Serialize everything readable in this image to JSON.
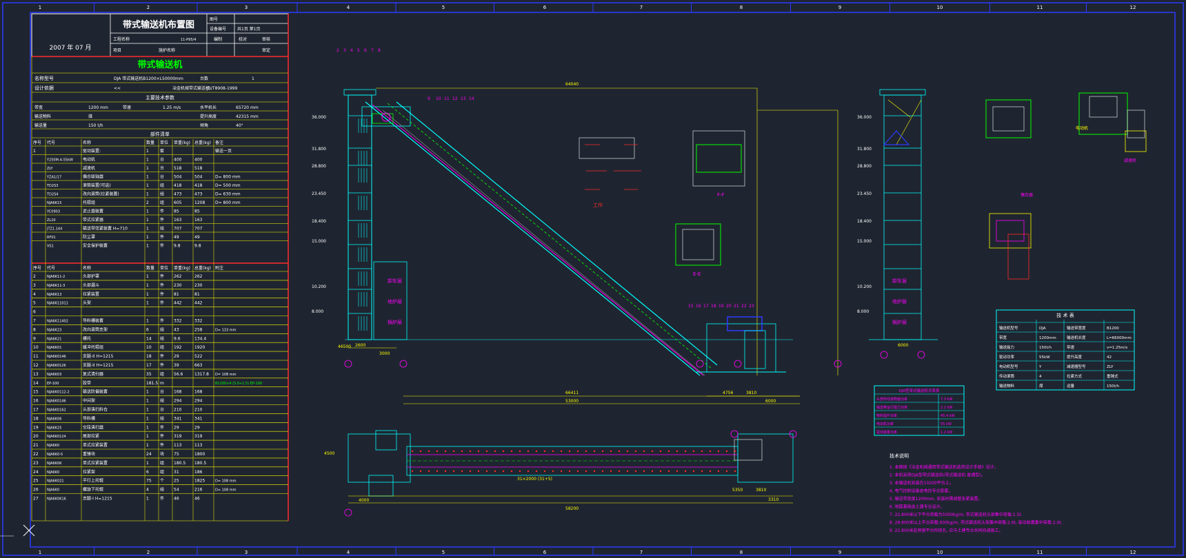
{
  "colors": {
    "bg": "#1f2530",
    "border": "#2b3bff",
    "red": "#ff2a2a",
    "yellow": "#ffff00",
    "cyan": "#00ffff",
    "green": "#00ff00",
    "magenta": "#ff00ff",
    "white": "#ffffff"
  },
  "zone_numbers": [
    "1",
    "2",
    "3",
    "4",
    "5",
    "6",
    "7",
    "8",
    "9",
    "10",
    "11",
    "12"
  ],
  "title_block": {
    "drawing_title": "带式输送机布置图",
    "date": "2007 年 07 月",
    "cells_right": [
      "图号",
      "设备编号",
      "共1页 第1页",
      "编制",
      "校对",
      "审核",
      "审定"
    ],
    "left_labels": [
      "工程名称",
      "项目",
      "施护名称"
    ],
    "project_code": "11-P95/4"
  },
  "section_title": "带式输送机",
  "main_rows": [
    [
      "名称型号",
      "DJA 带式输送机B1200×L50000mm",
      "台数",
      "1"
    ],
    [
      "设计依据",
      "<<",
      "冶金机械带式输送机",
      "JB/T8908-1999"
    ]
  ],
  "tech_header": "主要技术参数",
  "tech_rows": [
    [
      "带宽",
      "1200 mm",
      "带速",
      "1.25 m/s",
      "水平机长",
      "65720 mm"
    ],
    [
      "输送物料",
      "煤",
      "",
      "",
      "提升高度",
      "42315 mm"
    ],
    [
      "输送量",
      "150 t/h",
      "",
      "",
      "倾角",
      "40°"
    ]
  ],
  "parts_header": "部件清单",
  "parts_cols": [
    "序号",
    "代号",
    "名称",
    "数量",
    "单位",
    "单重(kg)",
    "总重(kg)",
    "备注"
  ],
  "parts_rows": [
    [
      "1",
      "",
      "驱动装置:",
      "1",
      "套",
      "",
      "",
      "输送一页"
    ],
    [
      "",
      "Y250M-4-55kW",
      "电动机",
      "1",
      "台",
      "400",
      "400",
      ""
    ],
    [
      "",
      "ZLY",
      "减速机",
      "1",
      "台",
      "518",
      "518",
      ""
    ],
    [
      "",
      "YZA1/17",
      "偶合联轴器",
      "1",
      "台",
      "504",
      "504",
      "D= 800 mm"
    ],
    [
      "",
      "TD2S3",
      "滚筒装置(可选)",
      "1",
      "组",
      "418",
      "418",
      "D= 500 mm"
    ],
    [
      "",
      "TD2S4",
      "改向滚筒(拉紧装置)",
      "1",
      "组",
      "473",
      "473",
      "D= 630 mm"
    ],
    [
      "",
      "NJA6K15",
      "托辊组",
      "2",
      "组",
      "605",
      "1208",
      "D= 800 mm"
    ],
    [
      "",
      "YC0903",
      "逆止器装置",
      "1",
      "件",
      "85",
      "85",
      ""
    ],
    [
      "",
      "ZL10",
      "带式拉紧器",
      "1",
      "件",
      "163",
      "163",
      ""
    ],
    [
      "",
      "JTZ1.144",
      "输送带张紧装置 H=710",
      "1",
      "组",
      "707",
      "707",
      ""
    ],
    [
      "",
      "RF01",
      "防尘罩",
      "1",
      "件",
      "49",
      "49",
      ""
    ],
    [
      "",
      "VS1",
      "安全保护装置",
      "1",
      "件",
      "9.8",
      "9.8",
      ""
    ]
  ],
  "parts2_cols": [
    "序号",
    "代号",
    "名称",
    "数量",
    "单位",
    "单重(kg)",
    "总重(kg)",
    "附注"
  ],
  "parts2_rows": [
    [
      "2",
      "NJA6K11-2",
      "头部护罩",
      "1",
      "件",
      "262",
      "262",
      ""
    ],
    [
      "3",
      "NJA6K11-3",
      "头部漏斗",
      "1",
      "件",
      "230",
      "230",
      ""
    ],
    [
      "4",
      "NJA6K13",
      "拉紧装置",
      "1",
      "件",
      "81",
      "81",
      ""
    ],
    [
      "5",
      "NJA6K11011",
      "头架",
      "1",
      "件",
      "442",
      "442",
      ""
    ],
    [
      "6",
      "",
      "",
      "",
      "",
      "",
      "",
      ""
    ],
    [
      "7",
      "NJA6K11402",
      "导料槽装置",
      "1",
      "件",
      "332",
      "332",
      ""
    ],
    [
      "8",
      "NJA6K23",
      "改向滚筒支架",
      "6",
      "组",
      "43",
      "258",
      "D= 133 mm"
    ],
    [
      "9",
      "NJA6K21",
      "槽托",
      "14",
      "组",
      "9.6",
      "134.4",
      ""
    ],
    [
      "10",
      "NJA6K01",
      "缓冲托辊组",
      "10",
      "组",
      "192",
      "1920",
      ""
    ],
    [
      "11",
      "NJA6K0146",
      "支腿-II H=1215",
      "18",
      "件",
      "29",
      "522",
      ""
    ],
    [
      "12",
      "NJA6K0126",
      "支腿-II H=1215",
      "17",
      "件",
      "39",
      "663",
      ""
    ],
    [
      "13",
      "NJA6K03",
      "复式清扫器",
      "35",
      "组",
      "56.6",
      "1317.8",
      "D= 108 mm"
    ],
    [
      "14",
      "EP-100",
      "胶带",
      "181.5",
      "m",
      "",
      "",
      "B1200×4 (5.0+1.5) EP-100"
    ],
    [
      "15",
      "NJA6K0112-2",
      "输送防偏装置",
      "1",
      "台",
      "168",
      "168",
      ""
    ],
    [
      "16",
      "NJA6K0146",
      "中间架",
      "1",
      "组",
      "294",
      "294",
      ""
    ],
    [
      "17",
      "NJA6K0162",
      "头部清扫料仓",
      "1",
      "台",
      "210",
      "210",
      ""
    ],
    [
      "18",
      "NJA6K06",
      "导料槽",
      "1",
      "组",
      "341",
      "341",
      ""
    ],
    [
      "19",
      "NJA6K25",
      "空段清扫器",
      "1",
      "件",
      "29",
      "29",
      ""
    ],
    [
      "20",
      "NJA6K0124",
      "尾部拉紧",
      "1",
      "件",
      "319",
      "319",
      ""
    ],
    [
      "21",
      "NJA6K0",
      "单式拉紧装置",
      "1",
      "件",
      "113",
      "113",
      ""
    ],
    [
      "22",
      "NJA6K0-5",
      "重锤块",
      "24",
      "块",
      "75",
      "1800",
      ""
    ],
    [
      "23",
      "NJA6K0K",
      "单式拉紧装置",
      "1",
      "组",
      "180.5",
      "180.5",
      ""
    ],
    [
      "24",
      "NJA6K0",
      "拉紧架",
      "6",
      "组",
      "31",
      "186",
      ""
    ],
    [
      "25",
      "NJA6K021",
      "平行上托辊",
      "75",
      "个",
      "25",
      "1825",
      "D= 108 mm"
    ],
    [
      "26",
      "NJA6K0",
      "螺旋下托辊",
      "4",
      "组",
      "54",
      "216",
      "D= 108 mm"
    ],
    [
      "27",
      "NJA6K0K16",
      "支腿-I H=1215",
      "1",
      "件",
      "46",
      "46",
      ""
    ]
  ],
  "elevations_left": [
    "36.000",
    "31.800",
    "28.800",
    "23.450",
    "18.400",
    "15.000",
    "10.200",
    "8.000"
  ],
  "elevations_right": [
    "36.000",
    "31.800",
    "28.800",
    "23.450",
    "18.400",
    "15.000",
    "10.200",
    "8.000"
  ],
  "room_labels": [
    "卸车层",
    "地炉层",
    "锅炉层"
  ],
  "section_labels": {
    "section_ee": "E-E",
    "section_ff": "F-F",
    "section_work": "工作"
  },
  "dims": {
    "overall_top": "64040",
    "base1": "66411",
    "base2": "53000",
    "d4756": "4756",
    "d3810": "3810",
    "d6000": "6000",
    "plan1": "58200",
    "plan2": "31×2000 (31+5)",
    "plan3": "4000",
    "plan4": "4500",
    "plan5": "3810",
    "plan6": "5350",
    "plan7": "3310",
    "elev_top": "46500",
    "elev_bottom": "2600",
    "elev_bottom2": "3000",
    "right_bottom": "6000"
  },
  "notes_header": "技术说明",
  "notes": [
    "1. 本图按《冶金机械通用带式输送机选用设计手册》设计。",
    "2. 本机采用DJA型带式输送机(带式输送机 普通型)。",
    "3. 本输送机安装在10200平台上。",
    "4. 电气控制设备由电控专业配套。",
    "5. 输送带宽度1200mm, 安装时需调整张紧装置。",
    "6. 地面基础由土建专业设计。",
    "7. 22.800米以下平台荷载为5000kg/m, 带式输送机头部集中荷载:1.5t.",
    "8. 28.800米以上平台荷载:600kg/m, 带式输送机头架集中荷载:2.6t, 驱动装置集中荷载:2.0t.",
    "9. 22.800米处预留平台检修孔, 应与土建专业共同协调施工。"
  ],
  "param_table": {
    "title": "技 术 表",
    "rows": [
      [
        "输送机型号",
        "DJA",
        "输送带宽度",
        "B1200"
      ],
      [
        "带宽",
        "1200mm",
        "输送机长度",
        "L=66000mm"
      ],
      [
        "输送能力",
        "150t/h",
        "带速",
        "v=1.25m/s"
      ],
      [
        "驱动功率",
        "55kW",
        "提升高度",
        "42"
      ],
      [
        "电动机型号",
        "Y",
        "减速器型号",
        "ZLY"
      ],
      [
        "传动滚筒",
        "4",
        "拉紧方式",
        "重锤式"
      ],
      [
        "输送物料",
        "煤",
        "运量",
        "150t/h"
      ]
    ]
  },
  "power_table": {
    "title": "DJA型带式输送机功率表",
    "rows": [
      [
        "头部传动滚筒轴功率",
        "7.3 kW"
      ],
      [
        "输送带运行阻力功率",
        "2.1 kW"
      ],
      [
        "物料提升功率",
        "45.4 kW"
      ],
      [
        "电动机功率",
        "55 kW"
      ],
      [
        "驱动装置功率",
        "1.2 kW"
      ]
    ]
  },
  "head_labels": {
    "motor_label": "电动机",
    "reducer_label": "减速机",
    "coupling_label": "偶合器"
  },
  "callout_numbers_top": [
    "2",
    "3",
    "4",
    "5",
    "6",
    "7",
    "8"
  ],
  "callout_numbers_mid": [
    "9",
    "10",
    "11",
    "12",
    "13",
    "14"
  ],
  "callout_numbers_bottom": [
    "15",
    "16",
    "17",
    "18",
    "19",
    "20",
    "21",
    "22",
    "23"
  ],
  "grid_markers": [
    "A",
    "B",
    "C",
    "D"
  ]
}
